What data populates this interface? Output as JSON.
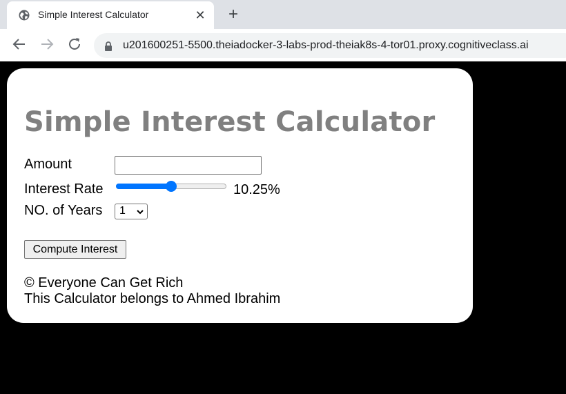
{
  "browser": {
    "tab_title": "Simple Interest Calculator",
    "tab_close_glyph": "✕",
    "new_tab_glyph": "+",
    "url": "u201600251-5500.theiadocker-3-labs-prod-theiak8s-4-tor01.proxy.cognitiveclass.ai",
    "icons": [
      "globe-icon",
      "back-arrow-icon",
      "forward-arrow-icon",
      "reload-icon",
      "lock-icon",
      "close-icon",
      "plus-icon"
    ]
  },
  "page": {
    "title": "Simple Interest Calculator",
    "amount_label": "Amount",
    "amount_value": "",
    "rate_label": "Interest Rate",
    "rate_value_text": "10.25%",
    "rate_slider_fraction": 0.5,
    "years_label": "NO. of Years",
    "years_selected": "1",
    "compute_label": "Compute Interest",
    "footer_copyright": "© Everyone Can Get Rich",
    "footer_owner": "This Calculator belongs to Ahmed Ibrahim"
  },
  "colors": {
    "title": "#808080",
    "slider_accent": "#0075ff",
    "page_background": "#000000",
    "card_background": "#ffffff"
  }
}
